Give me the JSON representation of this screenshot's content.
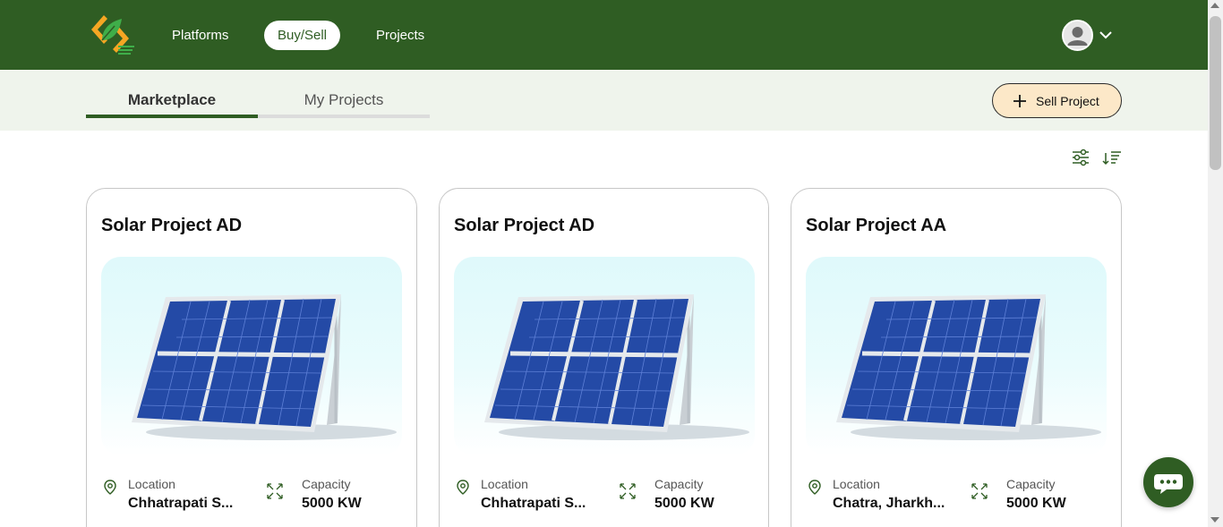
{
  "nav": {
    "logo_icon": "brand-logo-icon",
    "links": [
      "Platforms",
      "Buy/Sell",
      "Projects"
    ],
    "active": "Buy/Sell",
    "avatar_icon": "user-avatar-icon",
    "menu_icon": "chevron-down-icon"
  },
  "tabs": [
    "Marketplace",
    "My Projects"
  ],
  "active_tab": "Marketplace",
  "sell_button": {
    "label": "Sell Project",
    "icon": "plus-icon"
  },
  "tools": {
    "filter_icon": "filter-sliders-icon",
    "sort_icon": "sort-icon"
  },
  "cards": [
    {
      "title": "Solar Project AD",
      "location_label": "Location",
      "location": "Chhatrapati S...",
      "capacity_label": "Capacity",
      "capacity": "5000 KW"
    },
    {
      "title": "Solar Project AD",
      "location_label": "Location",
      "location": "Chhatrapati S...",
      "capacity_label": "Capacity",
      "capacity": "5000 KW"
    },
    {
      "title": "Solar Project AA",
      "location_label": "Location",
      "location": "Chatra, Jharkh...",
      "capacity_label": "Capacity",
      "capacity": "5000 KW"
    }
  ],
  "chat_icon": "chat-bubble-icon",
  "colors": {
    "primary": "#2f5d23",
    "subbar": "#eff4ec",
    "sell_button_bg": "#fce8c8"
  }
}
